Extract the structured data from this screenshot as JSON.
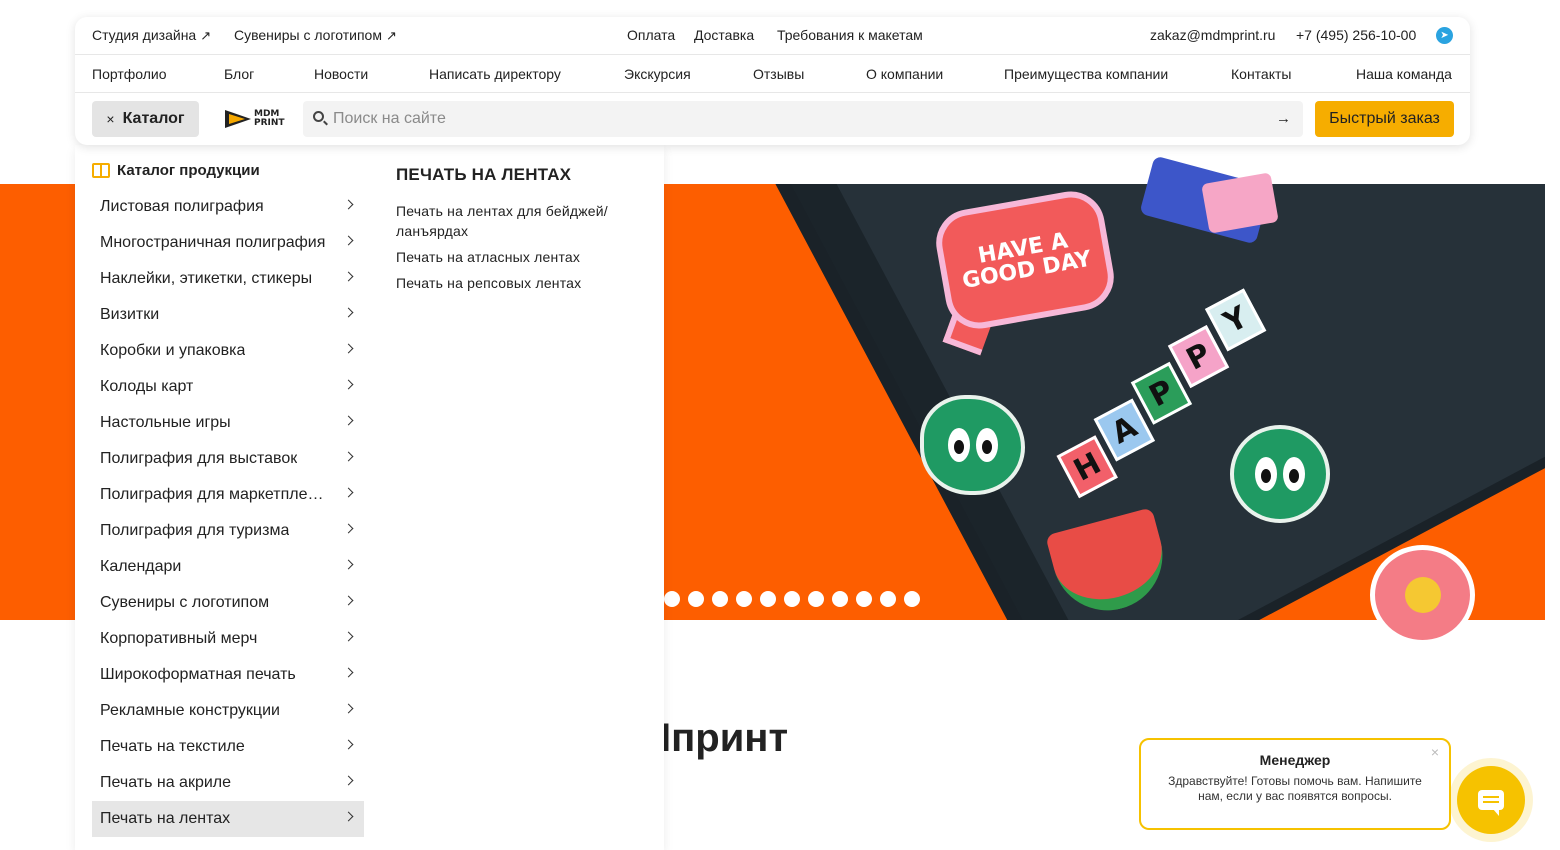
{
  "header": {
    "top_links": [
      {
        "label": "Студия дизайна",
        "arrow": "↗"
      },
      {
        "label": "Сувениры с логотипом",
        "arrow": "↗"
      }
    ],
    "center_links": [
      "Оплата",
      "Доставка",
      "Требования к макетам"
    ],
    "email": "zakaz@mdmprint.ru",
    "phone": "+7 (495) 256-10-00",
    "nav": [
      "Портфолио",
      "Блог",
      "Новости",
      "Написать директору",
      "Экскурсия",
      "Отзывы",
      "О компании",
      "Преимущества компании",
      "Контакты",
      "Наша команда"
    ],
    "catalog_button": {
      "close": "×",
      "label": "Каталог"
    },
    "logo": {
      "line1": "MDM",
      "line2": "PRINT"
    },
    "search": {
      "placeholder": "Поиск на сайте",
      "submit": "→"
    },
    "quick_order": "Быстрый заказ"
  },
  "catalog": {
    "title": "Каталог продукции",
    "items": [
      "Листовая полиграфия",
      "Многостраничная полиграфия",
      "Наклейки, этикетки, стикеры",
      "Визитки",
      "Коробки и упаковка",
      "Колоды карт",
      "Настольные игры",
      "Полиграфия для выставок",
      "Полиграфия для маркетплейсов",
      "Полиграфия для туризма",
      "Календари",
      "Сувениры с логотипом",
      "Корпоративный мерч",
      "Широкоформатная печать",
      "Рекламные конструкции",
      "Печать на текстиле",
      "Печать на акриле",
      "Печать на лентах"
    ],
    "active_index": 17,
    "submenu": {
      "title": "ПЕЧАТЬ НА ЛЕНТАХ",
      "items": [
        "Печать на лентах для бейджей/ ланъярдах",
        "Печать на атласных лентах",
        "Печать на репсовых лентах"
      ]
    }
  },
  "hero": {
    "bubble_text": "HAVE A GOOD DAY",
    "letters": [
      "H",
      "A",
      "P",
      "P",
      "Y"
    ],
    "slide_count": 11,
    "colors": {
      "background": "#fd5e00",
      "notebook": "#263139"
    }
  },
  "page_title_visible": "Іпринт",
  "chat": {
    "title": "Менеджер",
    "message": "Здравствуйте! Готовы помочь вам. Напишите нам, если у вас появятся вопросы.",
    "close": "×"
  },
  "colors": {
    "accent": "#f6ad00",
    "chat": "#f6c200"
  }
}
